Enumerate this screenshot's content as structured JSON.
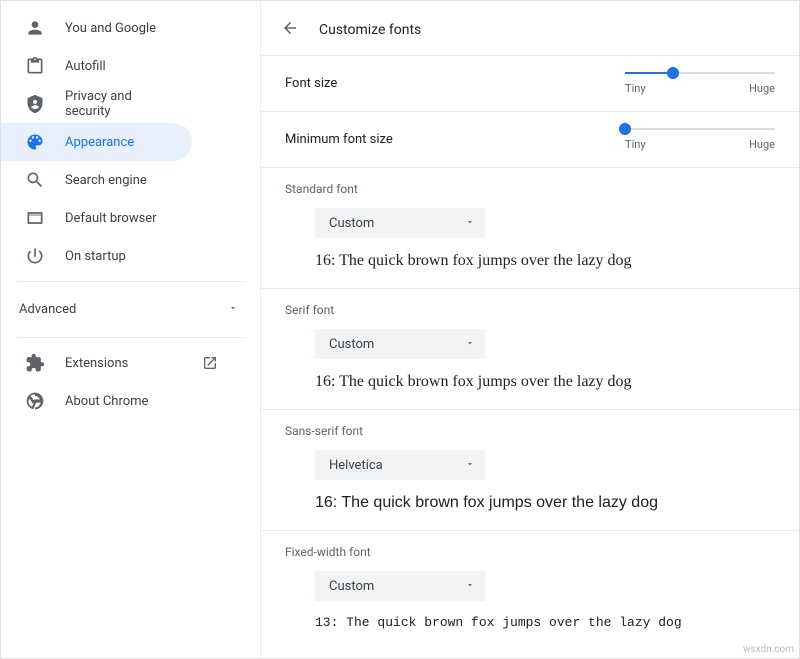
{
  "sidebar": {
    "items": [
      {
        "label": "You and Google"
      },
      {
        "label": "Autofill"
      },
      {
        "label": "Privacy and security"
      },
      {
        "label": "Appearance"
      },
      {
        "label": "Search engine"
      },
      {
        "label": "Default browser"
      },
      {
        "label": "On startup"
      }
    ],
    "advanced_label": "Advanced",
    "extensions_label": "Extensions",
    "about_label": "About Chrome"
  },
  "header": {
    "title": "Customize fonts"
  },
  "font_size": {
    "label": "Font size",
    "tiny": "Tiny",
    "huge": "Huge"
  },
  "min_font": {
    "label": "Minimum font size",
    "tiny": "Tiny",
    "huge": "Huge"
  },
  "standard": {
    "label": "Standard font",
    "value": "Custom",
    "preview": "16: The quick brown fox jumps over the lazy dog"
  },
  "serif": {
    "label": "Serif font",
    "value": "Custom",
    "preview": "16: The quick brown fox jumps over the lazy dog"
  },
  "sans": {
    "label": "Sans-serif font",
    "value": "Helvetica",
    "preview": "16: The quick brown fox jumps over the lazy dog"
  },
  "fixed": {
    "label": "Fixed-width font",
    "value": "Custom",
    "preview": "13: The quick brown fox jumps over the lazy dog"
  },
  "watermark": "wsxdn.com"
}
